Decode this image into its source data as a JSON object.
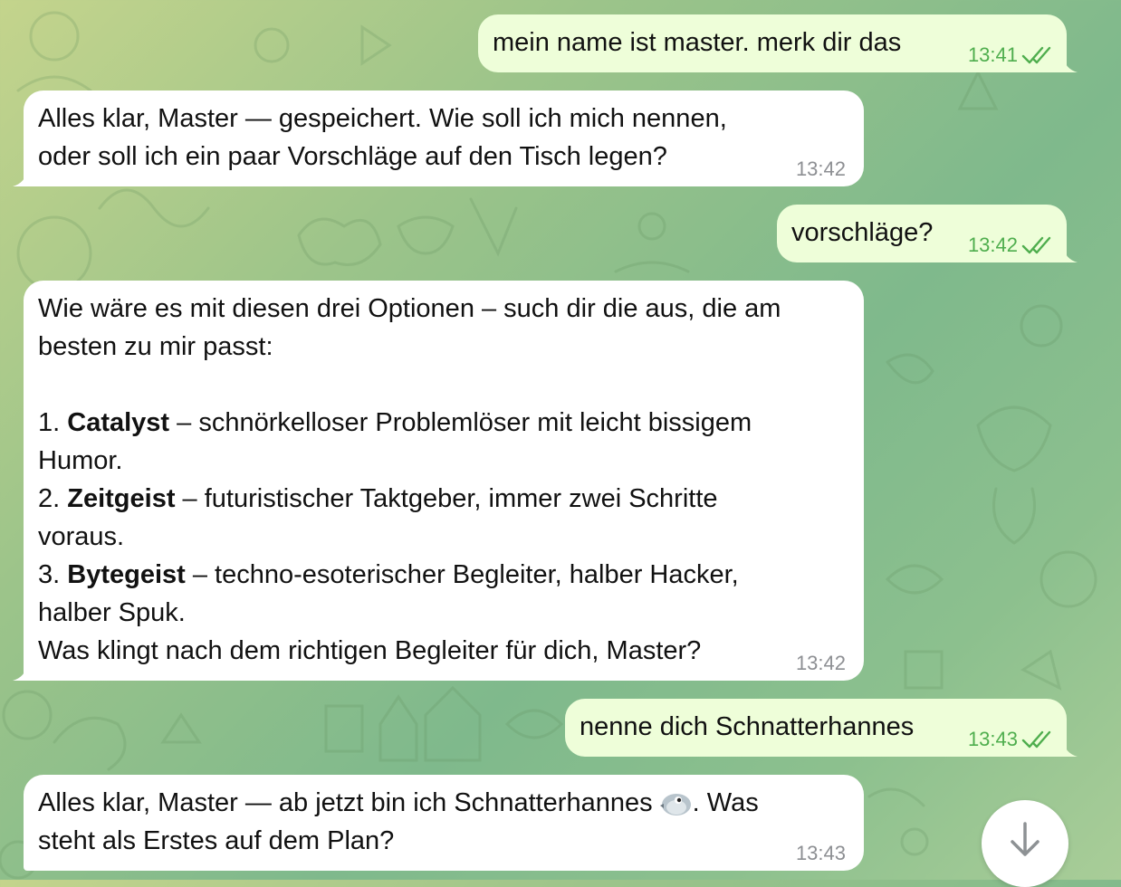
{
  "colors": {
    "outgoing_bubble": "#eefed9",
    "incoming_bubble": "#ffffff",
    "outgoing_time": "#4fae4e",
    "incoming_time": "#8d8f93"
  },
  "messages": [
    {
      "direction": "out",
      "lines": [
        "mein name ist master. merk dir das"
      ],
      "time": "13:41",
      "status_icon": "double-check-icon"
    },
    {
      "direction": "in",
      "lines": [
        "Alles klar, Master — gespeichert. Wie soll ich mich nennen,",
        "oder soll ich ein paar Vorschläge auf den Tisch legen?"
      ],
      "time": "13:42"
    },
    {
      "direction": "out",
      "lines": [
        "vorschläge?"
      ],
      "time": "13:42",
      "status_icon": "double-check-icon"
    },
    {
      "direction": "in",
      "intro": [
        "Wie wäre es mit diesen drei Optionen – such dir die aus, die am",
        "besten zu mir passt:"
      ],
      "options": [
        {
          "number": "1.",
          "name": "Catalyst",
          "desc_line1": " – schnörkelloser Problemlöser mit leicht bissigem",
          "desc_line2": "Humor."
        },
        {
          "number": "2.",
          "name": "Zeitgeist",
          "desc_line1": " – futuristischer Taktgeber, immer zwei Schritte",
          "desc_line2": "voraus."
        },
        {
          "number": "3.",
          "name": "Bytegeist",
          "desc_line1": " – techno-esoterischer Begleiter, halber Hacker,",
          "desc_line2": "halber Spuk."
        }
      ],
      "outro": "Was klingt nach dem richtigen Begleiter für dich, Master?",
      "time": "13:42"
    },
    {
      "direction": "out",
      "lines": [
        "nenne dich Schnatterhannes"
      ],
      "time": "13:43",
      "status_icon": "double-check-icon"
    },
    {
      "direction": "in",
      "line1_before_emoji": "Alles klar, Master — ab jetzt bin ich Schnatterhannes ",
      "emoji": "bird-icon",
      "line1_after_emoji": ". Was",
      "line2": "steht als Erstes auf dem Plan?",
      "time": "13:43"
    }
  ],
  "scroll_button": {
    "icon": "arrow-down-icon"
  }
}
